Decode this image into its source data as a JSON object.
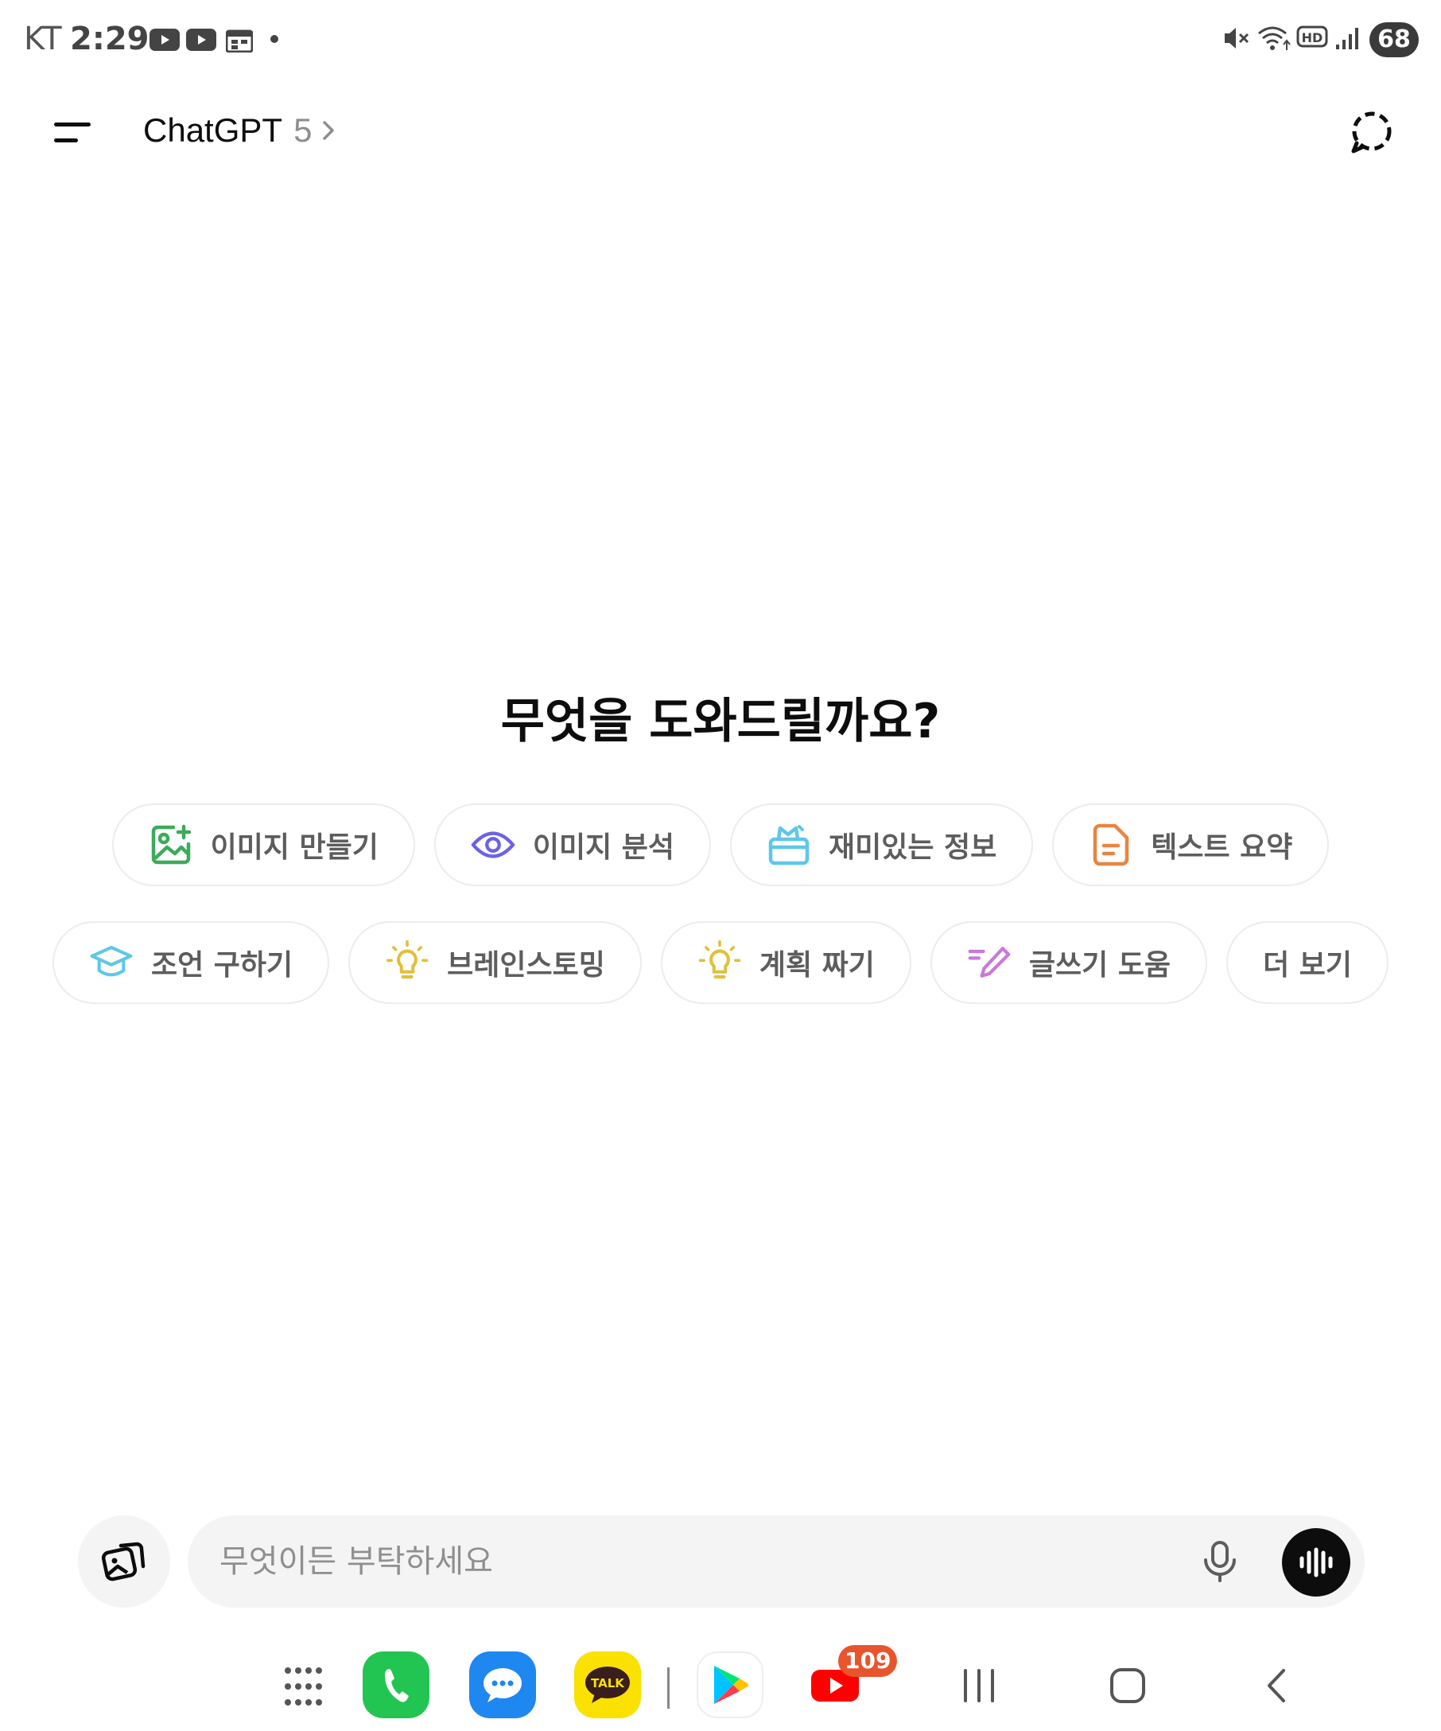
{
  "status_bar": {
    "carrier": "KT",
    "time": "2:29",
    "battery": "68"
  },
  "header": {
    "app_name": "ChatGPT",
    "model_version": "5"
  },
  "main": {
    "headline": "무엇을 도와드릴까요?",
    "chips_row1": [
      {
        "label": "이미지 만들기",
        "icon": "image-create-icon",
        "color": "#3bab5a"
      },
      {
        "label": "이미지 분석",
        "icon": "eye-icon",
        "color": "#6b62e8"
      },
      {
        "label": "재미있는 정보",
        "icon": "gift-box-icon",
        "color": "#5ec7e8"
      },
      {
        "label": "텍스트 요약",
        "icon": "document-icon",
        "color": "#e88540"
      }
    ],
    "chips_row2": [
      {
        "label": "조언 구하기",
        "icon": "graduation-cap-icon",
        "color": "#5ec7e8"
      },
      {
        "label": "브레인스토밍",
        "icon": "lightbulb-icon",
        "color": "#e0c03a"
      },
      {
        "label": "계획 짜기",
        "icon": "lightbulb-icon",
        "color": "#e0c03a"
      },
      {
        "label": "글쓰기 도움",
        "icon": "pen-icon",
        "color": "#c77ad8"
      },
      {
        "label": "더 보기",
        "icon": "",
        "color": ""
      }
    ]
  },
  "composer": {
    "placeholder": "무엇이든 부탁하세요"
  },
  "dock": {
    "youtube_badge": "109",
    "kakao_label": "TALK"
  }
}
